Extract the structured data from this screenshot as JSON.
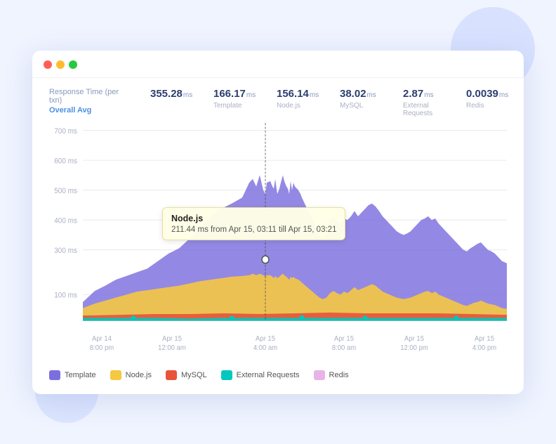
{
  "titlebar": {
    "dots": [
      "red",
      "yellow",
      "green"
    ]
  },
  "metrics": {
    "label": "Response Time (per txn)",
    "sublabel": "Overall Avg",
    "items": [
      {
        "value": "355.28",
        "unit": "ms",
        "name": "Overall Avg",
        "highlight": true
      },
      {
        "value": "166.17",
        "unit": "ms",
        "name": "Template"
      },
      {
        "value": "156.14",
        "unit": "ms",
        "name": "Node.js"
      },
      {
        "value": "38.02",
        "unit": "ms",
        "name": "MySQL"
      },
      {
        "value": "2.87",
        "unit": "ms",
        "name": "External Requests"
      },
      {
        "value": "0.0039",
        "unit": "ms",
        "name": "Redis"
      }
    ]
  },
  "chart": {
    "y_labels": [
      "700 ms",
      "600 ms",
      "500 ms",
      "400 ms",
      "300 ms",
      "100 ms"
    ],
    "x_labels": [
      "Apr 14\n8:00 pm",
      "Apr 15\n12:00 am",
      "Apr 15\n4:00 am",
      "Apr 15\n8:00 am",
      "Apr 15\n12:00 pm",
      "Apr 15\n4:00 pm"
    ]
  },
  "tooltip": {
    "title": "Node.js",
    "body": "211.44 ms from Apr 15, 03:11 till Apr 15, 03:21"
  },
  "legend": [
    {
      "label": "Template",
      "color": "#7b6fde"
    },
    {
      "label": "Node.js",
      "color": "#f5c842"
    },
    {
      "label": "MySQL",
      "color": "#e8533a"
    },
    {
      "label": "External Requests",
      "color": "#00c8c0"
    },
    {
      "label": "Redis",
      "color": "#e8b4e8"
    }
  ]
}
